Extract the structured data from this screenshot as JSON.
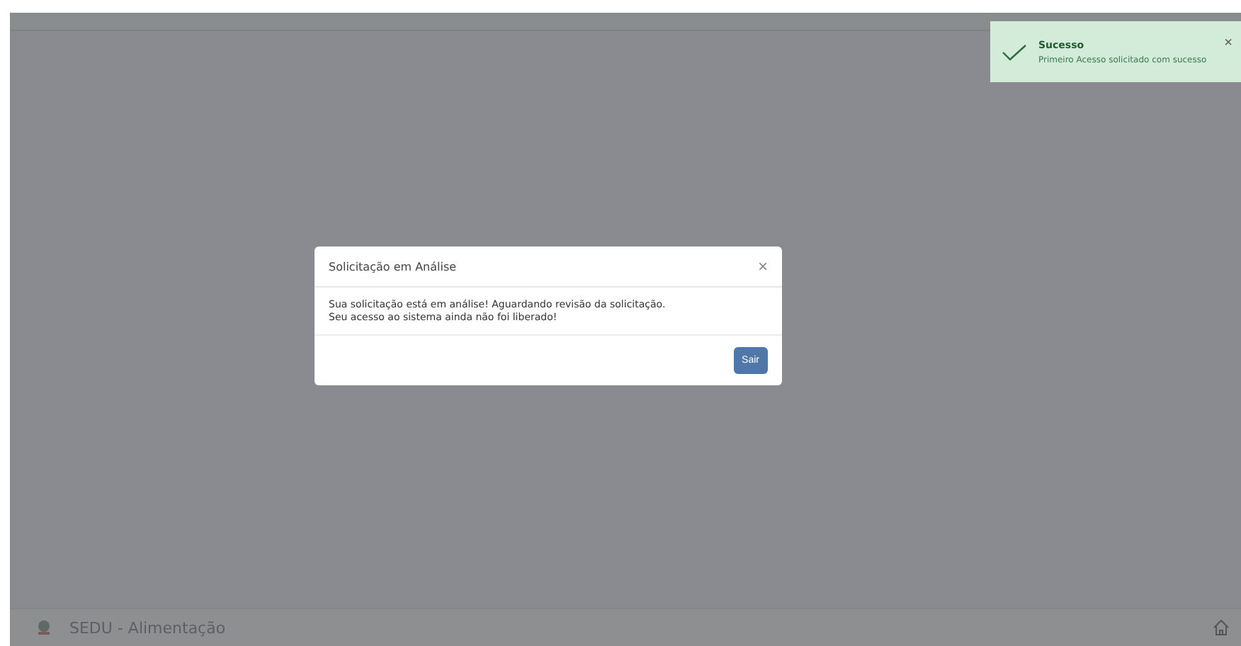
{
  "footer": {
    "title": "SEDU - Alimentação"
  },
  "modal": {
    "title": "Solicitação em Análise",
    "close": "×",
    "lines": [
      "Sua solicitação está em análise! Aguardando revisão da solicitação.",
      "Seu acesso ao sistema ainda não foi liberado!"
    ],
    "button": "Sair"
  },
  "toast": {
    "title": "Sucesso",
    "message": "Primeiro Acesso solicitado com sucesso",
    "close": "×"
  }
}
